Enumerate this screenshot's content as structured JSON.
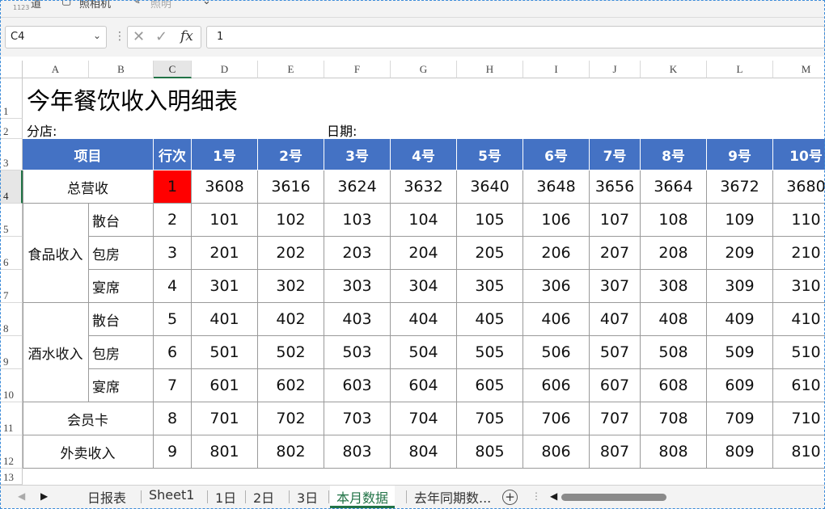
{
  "toolbar": {
    "items": [
      "道",
      "照相机",
      "照明"
    ],
    "small": "1123"
  },
  "formula_bar": {
    "name_box": "C4",
    "formula": "1",
    "fx": "fx"
  },
  "columns": [
    "A",
    "B",
    "C",
    "D",
    "E",
    "F",
    "G",
    "H",
    "I",
    "J",
    "K",
    "L",
    "M"
  ],
  "selected_column": "C",
  "rows": [
    "1",
    "2",
    "3",
    "4",
    "5",
    "6",
    "7",
    "8",
    "9",
    "10",
    "11",
    "12",
    "13"
  ],
  "selected_row": "4",
  "sheet": {
    "title": "今年餐饮收入明细表",
    "branch_label": "分店:",
    "date_label": "日期:",
    "headers": {
      "item": "项目",
      "line": "行次",
      "days": [
        "1号",
        "2号",
        "3号",
        "4号",
        "5号",
        "6号",
        "7号",
        "8号",
        "9号",
        "10号"
      ]
    },
    "data": [
      {
        "group": "总营收",
        "sub": "",
        "line": "1",
        "values": [
          "3608",
          "3616",
          "3624",
          "3632",
          "3640",
          "3648",
          "3656",
          "3664",
          "3672",
          "3680"
        ]
      },
      {
        "group": "食品收入",
        "sub": "散台",
        "line": "2",
        "values": [
          "101",
          "102",
          "103",
          "104",
          "105",
          "106",
          "107",
          "108",
          "109",
          "110"
        ]
      },
      {
        "group": "",
        "sub": "包房",
        "line": "3",
        "values": [
          "201",
          "202",
          "203",
          "204",
          "205",
          "206",
          "207",
          "208",
          "209",
          "210"
        ]
      },
      {
        "group": "",
        "sub": "宴席",
        "line": "4",
        "values": [
          "301",
          "302",
          "303",
          "304",
          "305",
          "306",
          "307",
          "308",
          "309",
          "310"
        ]
      },
      {
        "group": "酒水收入",
        "sub": "散台",
        "line": "5",
        "values": [
          "401",
          "402",
          "403",
          "404",
          "405",
          "406",
          "407",
          "408",
          "409",
          "410"
        ]
      },
      {
        "group": "",
        "sub": "包房",
        "line": "6",
        "values": [
          "501",
          "502",
          "503",
          "504",
          "505",
          "506",
          "507",
          "508",
          "509",
          "510"
        ]
      },
      {
        "group": "",
        "sub": "宴席",
        "line": "7",
        "values": [
          "601",
          "602",
          "603",
          "604",
          "605",
          "606",
          "607",
          "608",
          "609",
          "610"
        ]
      },
      {
        "group": "会员卡",
        "sub": "",
        "line": "8",
        "values": [
          "701",
          "702",
          "703",
          "704",
          "705",
          "706",
          "707",
          "708",
          "709",
          "710"
        ]
      },
      {
        "group": "外卖收入",
        "sub": "",
        "line": "9",
        "values": [
          "801",
          "802",
          "803",
          "804",
          "805",
          "806",
          "807",
          "808",
          "809",
          "810"
        ]
      }
    ],
    "highlight_color": "#ff0000",
    "header_color": "#4472c4"
  },
  "tabs": {
    "sheets": [
      "日报表",
      "Sheet1",
      "1日",
      "2日",
      "3日",
      "本月数据",
      "去年同期数..."
    ],
    "active": "本月数据",
    "add_label": "+"
  }
}
